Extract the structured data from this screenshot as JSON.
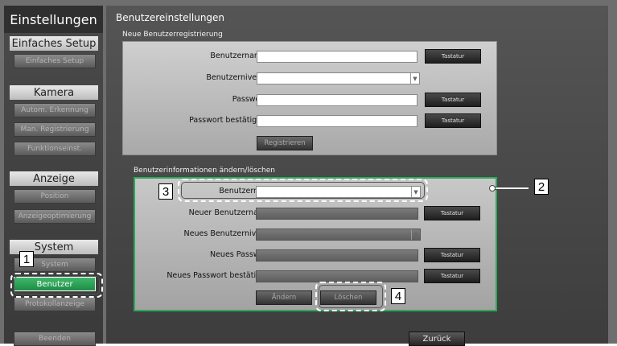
{
  "sidebar": {
    "title": "Einstellungen",
    "sections": [
      {
        "header": "Einfaches Setup",
        "items": [
          "Einfaches Setup"
        ]
      },
      {
        "header": "Kamera",
        "items": [
          "Autom. Erkennung",
          "Man. Registrierung",
          "Funktionseinst."
        ]
      },
      {
        "header": "Anzeige",
        "items": [
          "Position",
          "Anzeigeoptimierung"
        ]
      },
      {
        "header": "System",
        "items": [
          "System",
          "Benutzer",
          "Protokollanzeige"
        ]
      }
    ],
    "exit": "Beenden"
  },
  "main": {
    "title": "Benutzereinstellungen",
    "register": {
      "group_label": "Neue Benutzerregistrierung",
      "username_label": "Benutzername",
      "level_label": "Benutzerniveau",
      "password_label": "Passwort",
      "confirm_label": "Passwort bestätigen",
      "keyboard": "Tastatur",
      "register_button": "Registrieren"
    },
    "edit": {
      "group_label": "Benutzerinformationen ändern/löschen",
      "username_label": "Benutzername",
      "new_username_label": "Neuer Benutzername",
      "new_level_label": "Neues Benutzerniveau",
      "new_password_label": "Neues Passwort",
      "confirm_new_label": "Neues Passwort bestätigen",
      "keyboard": "Tastatur",
      "change_button": "Ändern",
      "delete_button": "Löschen"
    },
    "back_button": "Zurück"
  },
  "callouts": [
    "1",
    "2",
    "3",
    "4"
  ],
  "colors": {
    "accent_green": "#2ea85a",
    "active_button": "#1e8c45"
  }
}
